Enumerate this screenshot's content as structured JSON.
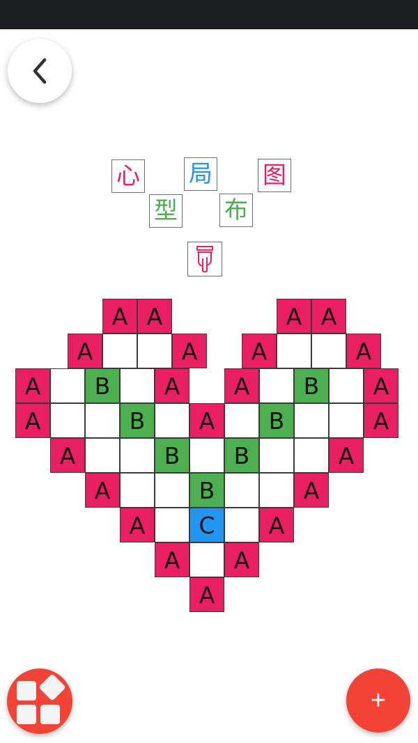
{
  "title_chars": [
    {
      "char": "心",
      "color": "#e91e63"
    },
    {
      "char": "局",
      "color": "#2196f3"
    },
    {
      "char": "图",
      "color": "#e91e63"
    },
    {
      "char": "型",
      "color": "#4caf50"
    },
    {
      "char": "布",
      "color": "#4caf50"
    }
  ],
  "pointer_color": "#e91e63",
  "legend_colors": {
    "A": "#e91e63",
    "B": "#4caf50",
    "C": "#2196f3"
  },
  "grid": [
    "..AA....AA..",
    ".AEEA..AEEA.",
    "AEBEA.AEBEA",
    "AEEBEAEBEEA",
    ".AEEBEBEEA.",
    "..AEEBEEA..",
    "...AECEA...",
    "....AEA....",
    ".....A....."
  ],
  "fab": {
    "add_label": "+"
  }
}
